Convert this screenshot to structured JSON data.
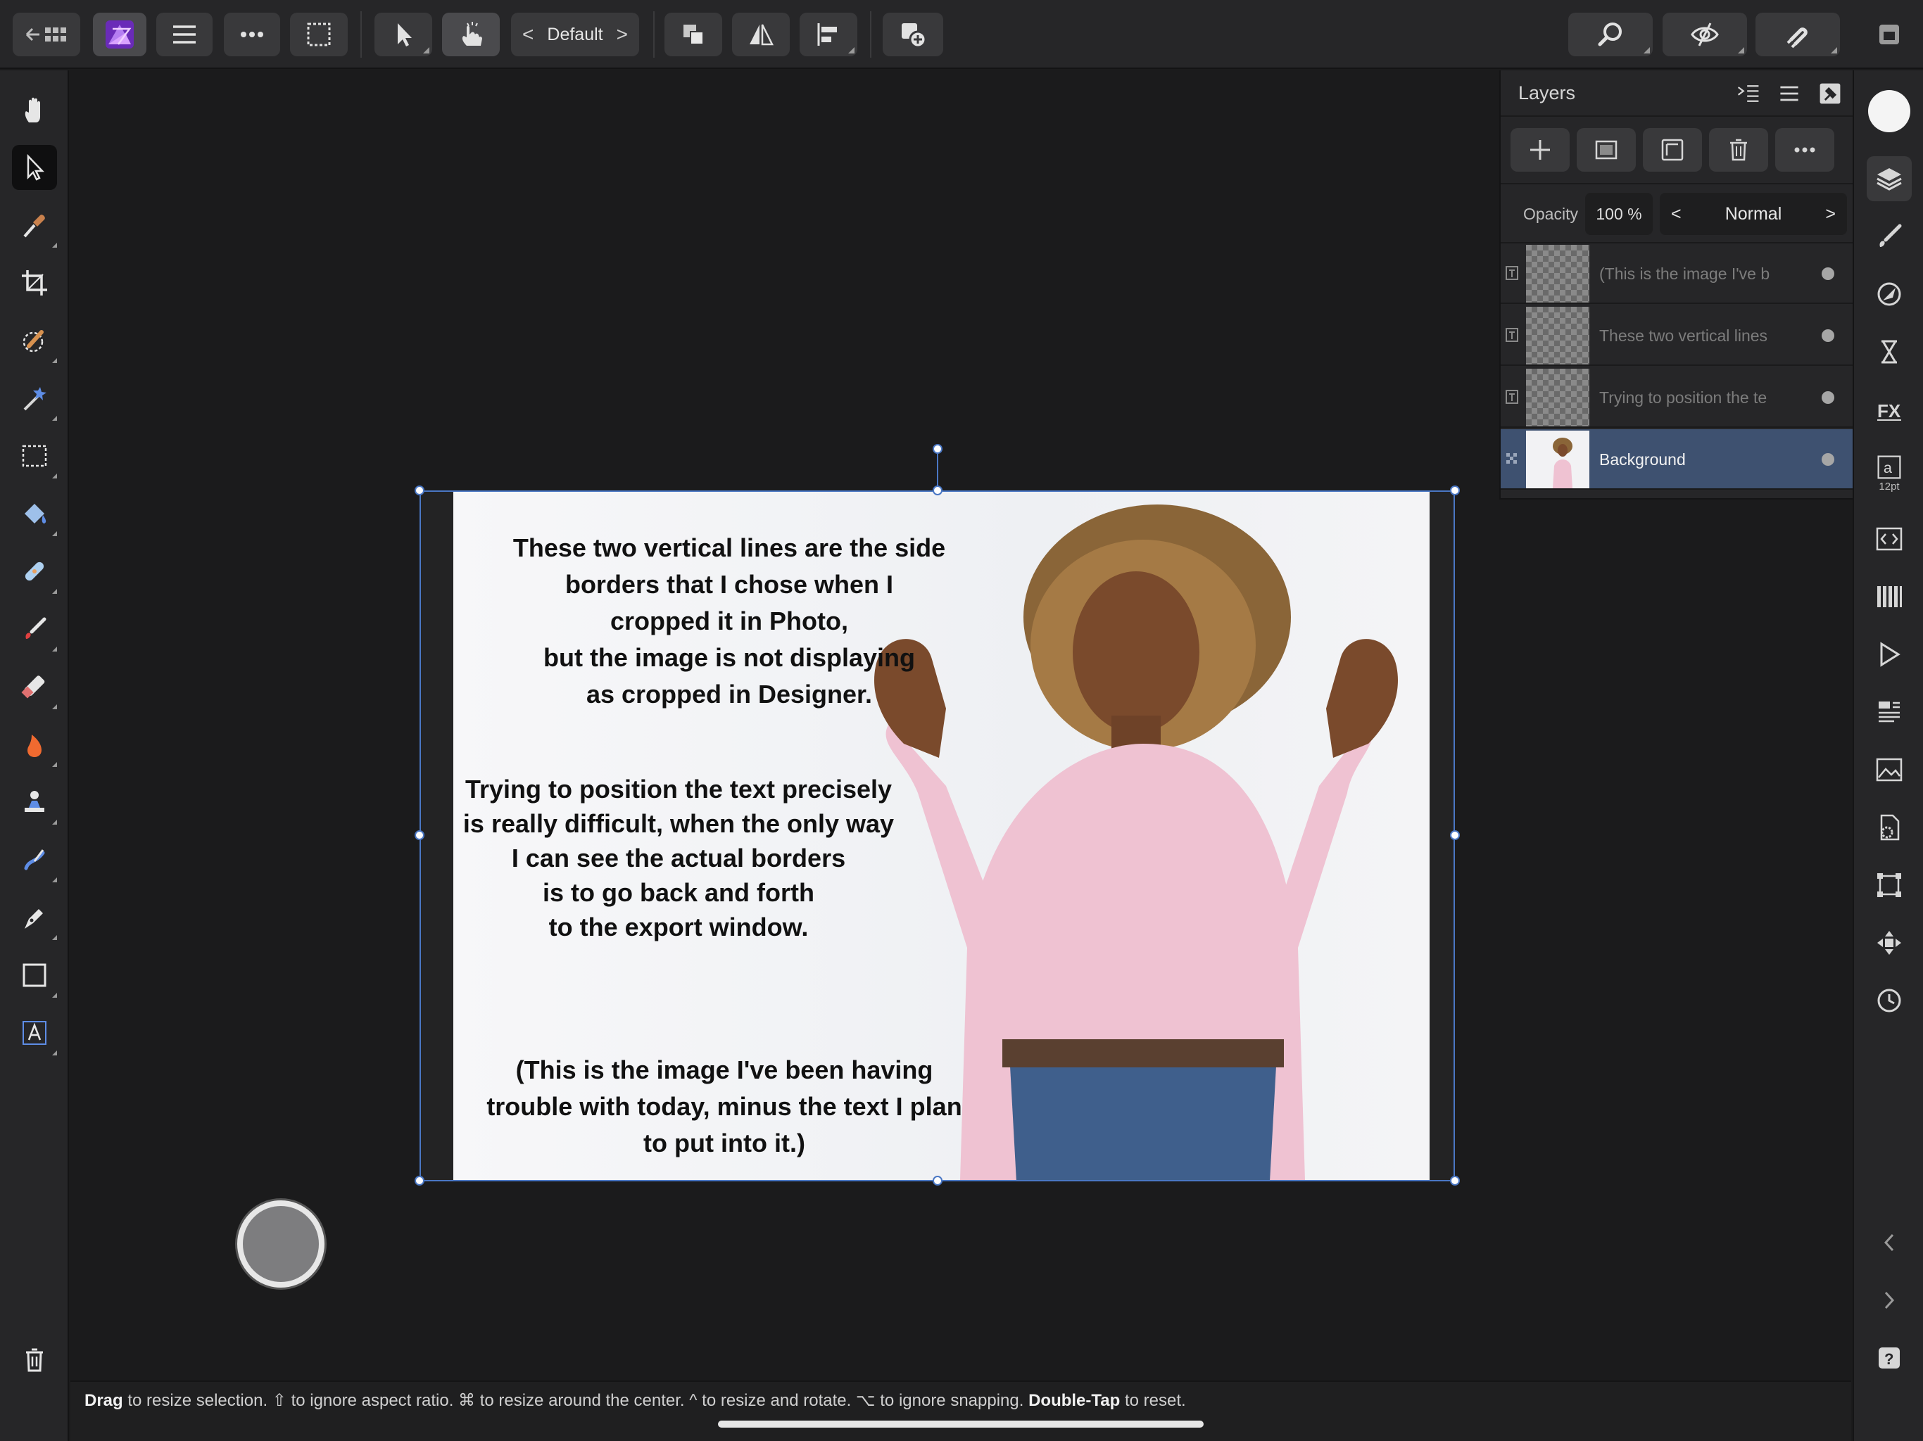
{
  "toolbar": {
    "preset_label": "Default",
    "preset_prev": "<",
    "preset_next": ">"
  },
  "left_tools": [
    "move-hand",
    "move-select",
    "color-picker",
    "crop",
    "paint-selection",
    "flood-select",
    "marquee",
    "flood-fill",
    "retouch",
    "paint-brush",
    "erase",
    "dodge-burn",
    "clone",
    "smudge",
    "pen",
    "rectangle",
    "text"
  ],
  "layers_panel": {
    "title": "Layers",
    "opacity_label": "Opacity",
    "opacity_value": "100 %",
    "blend_mode": "Normal",
    "blend_prev": "<",
    "blend_next": ">",
    "layers": [
      {
        "name": "(This is the image I've b",
        "type": "text",
        "selected": false
      },
      {
        "name": "These two vertical lines",
        "type": "text",
        "selected": false
      },
      {
        "name": "Trying to position the te",
        "type": "text",
        "selected": false
      },
      {
        "name": "Background",
        "type": "pixel",
        "selected": true
      }
    ]
  },
  "canvas": {
    "caption_1": "These two vertical lines are the side\nborders that I chose when I\ncropped it in Photo,\nbut the image is not displaying\nas cropped in Designer.",
    "caption_2": "Trying to position the text precisely\nis really difficult, when the only way\nI can see the actual borders\nis to go back and forth\nto the export window.",
    "caption_3": "(This is the image I've been having\ntrouble with today, minus the text I plan\nto put into it.)"
  },
  "right_studio": {
    "text_style_size": "12pt"
  },
  "status": {
    "hint_drag": "Drag",
    "hint_1": " to resize selection. ⇧ to ignore aspect ratio. ⌘ to resize around the center. ^ to resize and rotate. ⌥ to ignore snapping. ",
    "hint_doubletap": "Double-Tap",
    "hint_2": " to reset."
  },
  "colors": {
    "accent": "#4a77c4",
    "selected_layer": "#3e5170",
    "app_icon": "#8b3fd9"
  }
}
